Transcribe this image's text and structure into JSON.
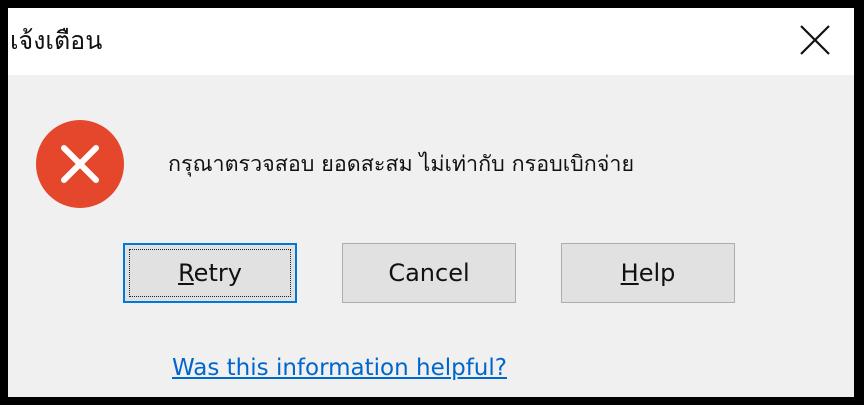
{
  "window": {
    "title": "เจ้งเตือน",
    "close_icon": "close-icon"
  },
  "message": {
    "icon": "error-icon",
    "icon_color": "#e4472b",
    "text": "กรุณาตรวจสอบ ยอดสะสม ไม่เท่ากับ กรอบเบิกจ่าย"
  },
  "buttons": {
    "retry": {
      "mnemonic": "R",
      "rest": "etry",
      "is_default": true
    },
    "cancel": {
      "label": "Cancel"
    },
    "help": {
      "mnemonic": "H",
      "rest": "elp"
    }
  },
  "link": {
    "text": "Was this information helpful?",
    "color": "#0066cc"
  },
  "colors": {
    "accent": "#0078d7",
    "dialog_background": "#f0f0f0",
    "titlebar_background": "#ffffff"
  }
}
